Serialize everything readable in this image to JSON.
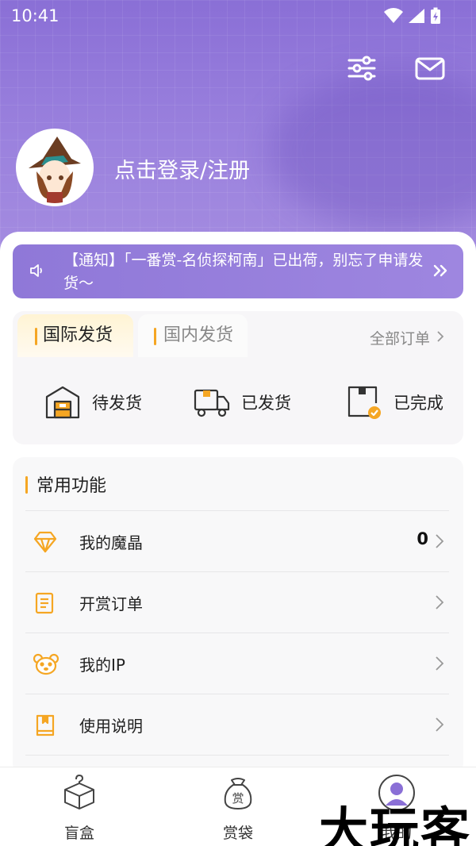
{
  "status_bar": {
    "time": "10:41"
  },
  "header": {
    "login_text": "点击登录/注册"
  },
  "notice": {
    "text": "【通知】「一番赏-名侦探柯南」已出荷，别忘了申请发货～"
  },
  "orders": {
    "tabs": [
      {
        "label": "国际发货",
        "active": true
      },
      {
        "label": "国内发货",
        "active": false
      }
    ],
    "all_orders_label": "全部订单",
    "statuses": [
      {
        "label": "待发货",
        "icon": "warehouse-icon"
      },
      {
        "label": "已发货",
        "icon": "truck-icon"
      },
      {
        "label": "已完成",
        "icon": "box-check-icon"
      }
    ]
  },
  "functions": {
    "title": "常用功能",
    "items": [
      {
        "label": "我的魔晶",
        "value": "0",
        "icon": "diamond-icon"
      },
      {
        "label": "开赏订单",
        "icon": "list-doc-icon"
      },
      {
        "label": "我的IP",
        "icon": "bear-face-icon"
      },
      {
        "label": "使用说明",
        "icon": "bookmark-book-icon"
      }
    ]
  },
  "tabbar": {
    "items": [
      {
        "label": "盲盒",
        "icon": "mystery-box-icon"
      },
      {
        "label": "赏袋",
        "icon": "prize-bag-icon",
        "glyph": "赏"
      },
      {
        "label": "我的",
        "icon": "profile-icon",
        "active": true
      }
    ]
  },
  "watermark": {
    "text": "大玩客"
  },
  "colors": {
    "accent": "#8a6fd6",
    "highlight": "#f5a623"
  }
}
